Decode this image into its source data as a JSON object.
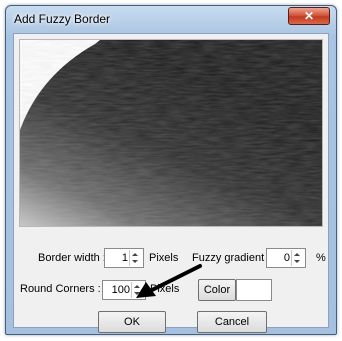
{
  "window": {
    "title": "Add Fuzzy Border",
    "close_glyph": "✕"
  },
  "form": {
    "border_width_label": "Border width :",
    "border_width_value": "1",
    "border_width_unit": "Pixels",
    "fuzzy_gradient_label": "Fuzzy gradient :",
    "fuzzy_gradient_value": "0",
    "fuzzy_gradient_unit": "%",
    "round_corners_label": "Round Corners :",
    "round_corners_value": "100",
    "round_corners_unit": "Pixels",
    "color_button_label": "Color",
    "color_value": "#ffffff"
  },
  "buttons": {
    "ok": "OK",
    "cancel": "Cancel"
  },
  "icons": {
    "close": "close-icon",
    "annotation": "arrow-icon"
  }
}
